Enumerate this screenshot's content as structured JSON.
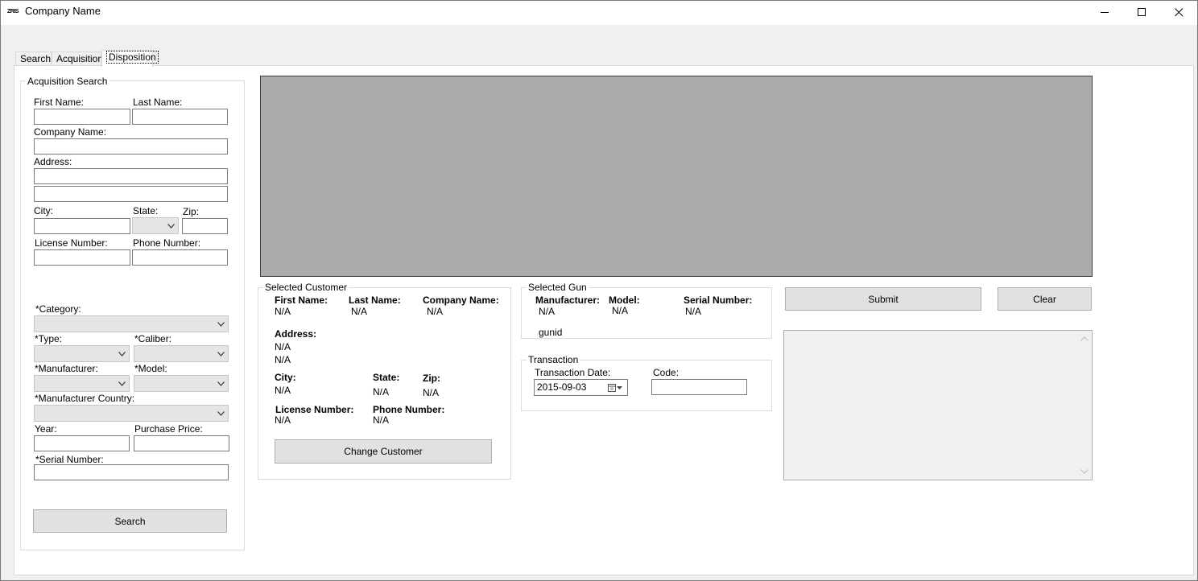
{
  "window": {
    "title": "Company Name",
    "icon_text": "ZRIS",
    "controls": [
      "minimize",
      "maximize",
      "close"
    ]
  },
  "tabs": [
    {
      "label": "Search",
      "active": false
    },
    {
      "label": "Acquisition",
      "active": false
    },
    {
      "label": "Disposition",
      "active": true
    }
  ],
  "acquisition_search": {
    "title": "Acquisition Search",
    "first_name_label": "First Name:",
    "last_name_label": "Last Name:",
    "company_name_label": "Company Name:",
    "address_label": "Address:",
    "city_label": "City:",
    "state_label": "State:",
    "zip_label": "Zip:",
    "license_number_label": "License Number:",
    "phone_number_label": "Phone Number:",
    "category_label": "*Category:",
    "type_label": "*Type:",
    "caliber_label": "*Caliber:",
    "manufacturer_label": "*Manufacturer:",
    "model_label": "*Model:",
    "manufacturer_country_label": "*Manufacturer Country:",
    "year_label": "Year:",
    "purchase_price_label": "Purchase Price:",
    "serial_number_label": "*Serial Number:",
    "search_button": "Search"
  },
  "selected_customer": {
    "title": "Selected Customer",
    "first_name_label": "First Name:",
    "first_name_value": "N/A",
    "last_name_label": "Last Name:",
    "last_name_value": "N/A",
    "company_name_label": "Company Name:",
    "company_name_value": "N/A",
    "address_label": "Address:",
    "address_line1": "N/A",
    "address_line2": "N/A",
    "city_label": "City:",
    "city_value": "N/A",
    "state_label": "State:",
    "state_value": "N/A",
    "zip_label": "Zip:",
    "zip_value": "N/A",
    "license_number_label": "License Number:",
    "license_number_value": "N/A",
    "phone_number_label": "Phone Number:",
    "phone_number_value": "N/A",
    "change_button": "Change Customer"
  },
  "selected_gun": {
    "title": "Selected Gun",
    "manufacturer_label": "Manufacturer:",
    "manufacturer_value": "N/A",
    "model_label": "Model:",
    "model_value": "N/A",
    "serial_number_label": "Serial Number:",
    "serial_number_value": "N/A",
    "gunid_text": "gunid"
  },
  "transaction": {
    "title": "Transaction",
    "date_label": "Transaction Date:",
    "date_value": "2015-09-03",
    "code_label": "Code:"
  },
  "actions": {
    "submit_button": "Submit",
    "clear_button": "Clear"
  },
  "colors": {
    "preview_bg": "#ababab",
    "button_bg": "#e1e1e1",
    "combo_bg": "#e5e5e5",
    "window_bg": "#f0f0f0"
  }
}
